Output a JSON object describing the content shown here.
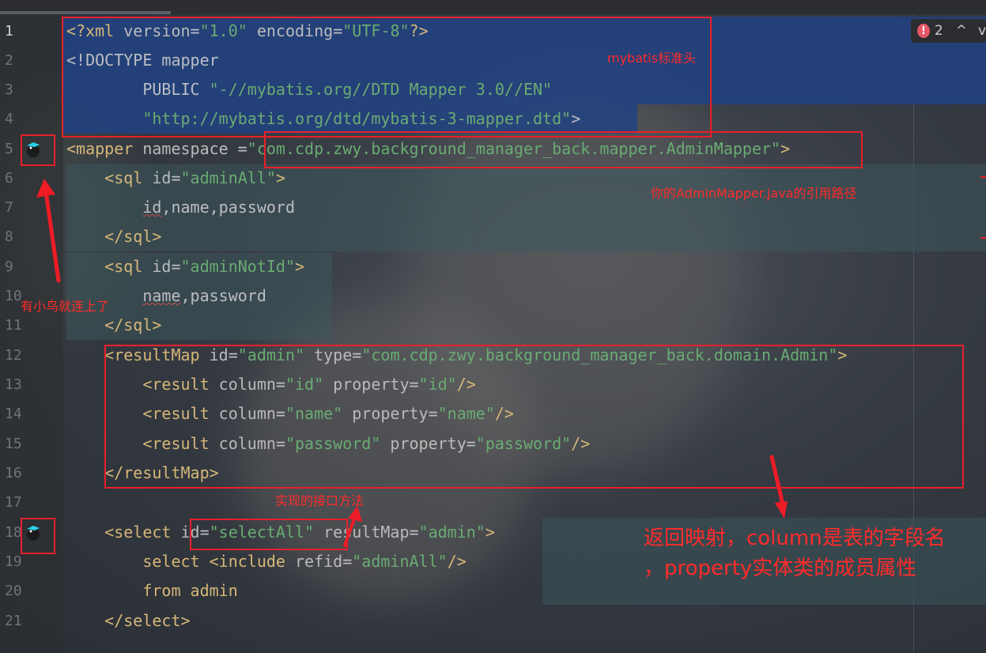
{
  "editor": {
    "error_count": "2",
    "line_numbers": [
      "1",
      "2",
      "3",
      "4",
      "5",
      "6",
      "7",
      "8",
      "9",
      "10",
      "11",
      "12",
      "13",
      "14",
      "15",
      "16",
      "17",
      "18",
      "19",
      "20",
      "21"
    ],
    "lines": {
      "l1": {
        "a": "<?xml ",
        "b": "version",
        "c": "=",
        "d": "\"1.0\"",
        "e": " encoding",
        "f": "=",
        "g": "\"UTF-8\"",
        "h": "?>"
      },
      "l2": {
        "a": "<!DOCTYPE ",
        "b": "mapper"
      },
      "l3": {
        "a": "        PUBLIC ",
        "b": "\"-//mybatis.org//DTD Mapper 3.0//EN\""
      },
      "l4": {
        "a": "        ",
        "b": "\"http://mybatis.org/dtd/mybatis-3-mapper.dtd\"",
        "c": ">"
      },
      "l5": {
        "a": "<mapper ",
        "b": "namespace ",
        "c": "=",
        "d": "\"com.cdp.zwy.background_manager_back.mapper.AdminMapper\"",
        "e": ">"
      },
      "l6": {
        "a": "    <sql ",
        "b": "id",
        "c": "=",
        "d": "\"adminAll\"",
        "e": ">"
      },
      "l7": {
        "a": "        ",
        "b": "id",
        "c": ",name,password"
      },
      "l8": {
        "a": "    </sql>"
      },
      "l9": {
        "a": "    <sql ",
        "b": "id",
        "c": "=",
        "d": "\"adminNotId\"",
        "e": ">"
      },
      "l10": {
        "a": "        ",
        "b": "name",
        "c": ",password"
      },
      "l11": {
        "a": "    </sql>"
      },
      "l12": {
        "a": "    <resultMap ",
        "b": "id",
        "c": "=",
        "d": "\"admin\"",
        "e": " type",
        "f": "=",
        "g": "\"com.cdp.zwy.background_manager_back.domain.Admin\"",
        "h": ">"
      },
      "l13": {
        "a": "        <result ",
        "b": "column",
        "c": "=",
        "d": "\"id\"",
        "e": " property",
        "f": "=",
        "g": "\"id\"",
        "h": "/>"
      },
      "l14": {
        "a": "        <result ",
        "b": "column",
        "c": "=",
        "d": "\"name\"",
        "e": " property",
        "f": "=",
        "g": "\"name\"",
        "h": "/>"
      },
      "l15": {
        "a": "        <result ",
        "b": "column",
        "c": "=",
        "d": "\"password\"",
        "e": " property",
        "f": "=",
        "g": "\"password\"",
        "h": "/>"
      },
      "l16": {
        "a": "    </resultMap>"
      },
      "l17": {
        "a": ""
      },
      "l18": {
        "a": "    <select ",
        "b": "id",
        "c": "=",
        "d": "\"selectAll\"",
        "e": " resultMap",
        "f": "=",
        "g": "\"admin\"",
        "h": ">"
      },
      "l19": {
        "a": "        select ",
        "b": "<include ",
        "c": "refid",
        "d": "=",
        "e": "\"adminAll\"",
        "f": "/>"
      },
      "l20": {
        "a": "        from admin"
      },
      "l21": {
        "a": "    </select>"
      }
    }
  },
  "annotations": {
    "header_note": "mybatis标准头",
    "namespace_note": "你的AdminMapper.java的引用路径",
    "bird_note": "有小鸟就连上了",
    "method_note": "实现的接口方法",
    "resultmap_note_line1": "返回映射，column是表的字段名",
    "resultmap_note_line2": "，property实体类的成员属性"
  },
  "colors": {
    "selection": "#214283",
    "annotation_red": "#e8202a",
    "tag": "#d5b778",
    "string": "#6aab73",
    "text": "#bcbec4"
  },
  "icons": [
    "mybatis-bird-icon",
    "error-icon",
    "chevron-up-icon",
    "chevron-down-icon"
  ]
}
